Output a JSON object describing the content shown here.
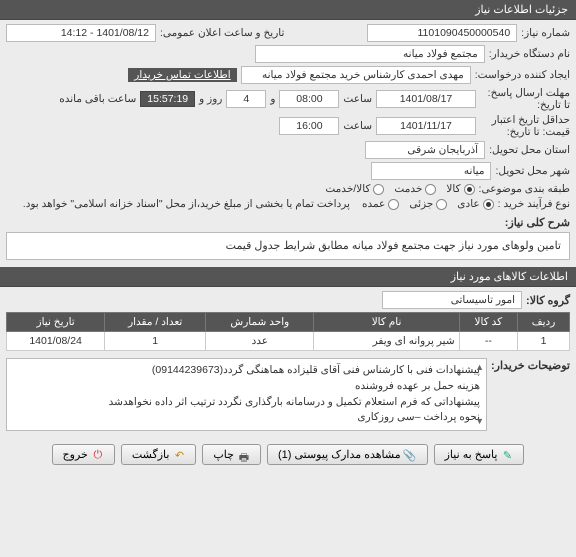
{
  "header": {
    "title": "جزئیات اطلاعات نیاز"
  },
  "form": {
    "need_no_label": "شماره نیاز:",
    "need_no": "1101090450000540",
    "announce_label": "تاریخ و ساعت اعلان عمومی:",
    "announce_value": "1401/08/12 - 14:12",
    "buyer_label": "نام دستگاه خریدار:",
    "buyer_value": "مجتمع فولاد میانه",
    "creator_label": "ایجاد کننده درخواست:",
    "creator_value": "مهدی احمدی کارشناس خرید مجتمع فولاد میانه",
    "contact_link": "اطلاعات تماس خریدار",
    "deadline_label": "حداقل تاریخ اعتبار قیمت: تا تاریخ:",
    "deadline_date": "1401/11/17",
    "saat": "ساعت",
    "deadline_time": "16:00",
    "reply_deadline_label": "مهلت ارسال پاسخ: تا تاریخ:",
    "reply_date": "1401/08/17",
    "reply_time": "08:00",
    "va": "و",
    "days": "4",
    "rooz_va": "روز و",
    "countdown": "15:57:19",
    "remain": "ساعت باقی مانده",
    "province_label": "استان محل تحویل:",
    "province_value": "آذربایجان شرقی",
    "city_label": "شهر محل تحویل:",
    "city_value": "میانه",
    "category_label": "طبقه بندی موضوعی:",
    "cat_kala": "کالا",
    "cat_khadamat": "خدمت",
    "cat_both": "کالا/خدمت",
    "process_label": "نوع فرآیند خرید :",
    "proc_adi": "عادی",
    "proc_jozei": "جزئی",
    "proc_omde": "عمده",
    "payment_note": "پرداخت تمام یا بخشی از مبلغ خرید،از محل \"اسناد خزانه اسلامی\" خواهد بود."
  },
  "desc": {
    "label": "شرح کلی نیاز:",
    "text": "تامین ولوهای مورد نیاز   جهت مجتمع فولاد میانه مطابق شرایط جدول قیمت"
  },
  "items_header": "اطلاعات کالاهای مورد نیاز",
  "group": {
    "label": "گروه کالا:",
    "value": "امور تاسیساتی"
  },
  "table": {
    "headers": [
      "ردیف",
      "کد کالا",
      "نام کالا",
      "واحد شمارش",
      "تعداد / مقدار",
      "تاریخ نیاز"
    ],
    "rows": [
      {
        "idx": "1",
        "code": "--",
        "name": "شیر پروانه ای ویفر",
        "unit": "عدد",
        "qty": "1",
        "date": "1401/08/24"
      }
    ]
  },
  "notes": {
    "label": "توضیحات خریدار:",
    "lines": [
      "پیشنهادات فنی با کارشناس فنی آقای قلیزاده هماهنگی گردد(09144239673)",
      "هزینه حمل بر عهده فروشنده",
      "پیشنهاداتی که فرم استعلام تکمیل و درسامانه بارگذاری نگردد ترتیب اثر داده نخواهدشد",
      "نحوه پرداخت –سی روزکاری"
    ]
  },
  "buttons": {
    "reply": "پاسخ به نیاز",
    "attach": "مشاهده مدارک پیوستی (1)",
    "print": "چاپ",
    "back": "بازگشت",
    "exit": "خروج"
  }
}
